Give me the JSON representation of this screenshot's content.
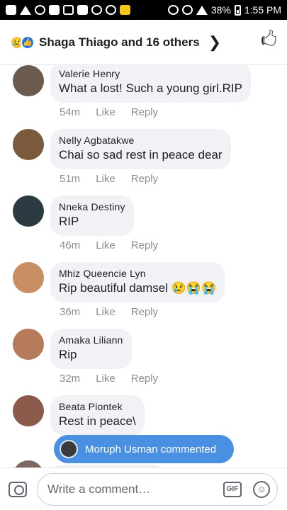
{
  "status_bar": {
    "battery": "38%",
    "time": "1:55 PM"
  },
  "header": {
    "title": "Shaga Thiago and 16 others",
    "sad_emoji": "😢",
    "like_glyph": "👍",
    "chevron": "❯",
    "like_button": "🖒"
  },
  "comments": [
    {
      "name": "Valerie Henry",
      "text": "What a lost! Such a young girl.RIP",
      "time": "54m",
      "like": "Like",
      "reply": "Reply",
      "avatar_color": "#6b5a4e"
    },
    {
      "name": "Nelly Agbatakwe",
      "text": "Chai so sad rest in peace dear",
      "time": "51m",
      "like": "Like",
      "reply": "Reply",
      "avatar_color": "#7a5a3c"
    },
    {
      "name": "Nneka Destiny",
      "text": "RIP",
      "time": "46m",
      "like": "Like",
      "reply": "Reply",
      "avatar_color": "#2b3a40"
    },
    {
      "name": "Mhiz Queencie Lyn",
      "text": "Rip beautiful damsel 😢😭😭",
      "time": "36m",
      "like": "Like",
      "reply": "Reply",
      "avatar_color": "#c98d63"
    },
    {
      "name": "Amaka Liliann",
      "text": "Rip",
      "time": "32m",
      "like": "Like",
      "reply": "Reply",
      "avatar_color": "#b47a5a"
    },
    {
      "name": "Beata Piontek",
      "text": "Rest in peace\\",
      "time": "",
      "like": "",
      "reply": "",
      "avatar_color": "#8c5a4a"
    }
  ],
  "toast": {
    "text": "Moruph Usman commented"
  },
  "composer": {
    "placeholder": "Write a comment…",
    "gif_label": "GIF",
    "emoji_glyph": "☺"
  }
}
